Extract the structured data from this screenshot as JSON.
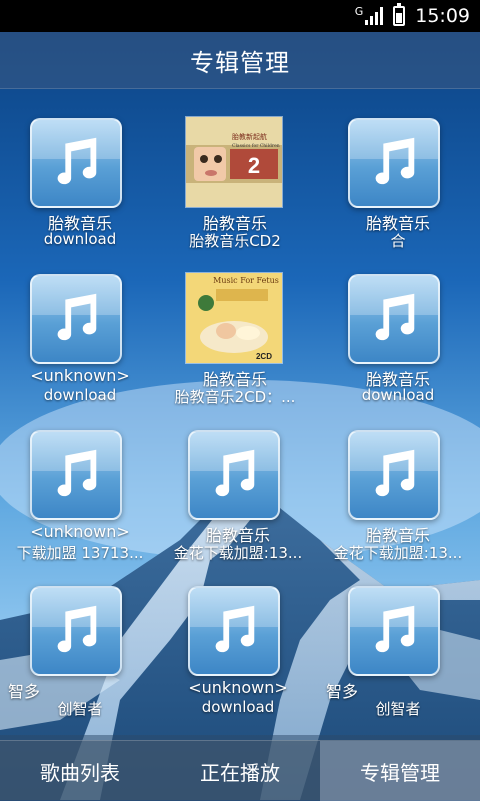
{
  "status_bar": {
    "network": "G",
    "time": "15:09",
    "battery_level": 0.6
  },
  "header": {
    "title": "专辑管理"
  },
  "albums": [
    {
      "icon": "music-note-icon",
      "line1": "胎教音乐",
      "line2": "download"
    },
    {
      "icon": "album-cover-classics",
      "line1": "胎教音乐",
      "line2": "胎教音乐CD2"
    },
    {
      "icon": "music-note-icon",
      "line1": "胎教音乐",
      "line2": "合"
    },
    {
      "icon": "music-note-icon",
      "line1": "<unknown>",
      "line2": "download"
    },
    {
      "icon": "album-cover-music-for-fetus",
      "line1": "胎教音乐",
      "line2": "胎教音乐2CD：..."
    },
    {
      "icon": "music-note-icon",
      "line1": "胎教音乐",
      "line2": "download"
    },
    {
      "icon": "music-note-icon",
      "line1": "<unknown>",
      "line2": "下载加盟 13713..."
    },
    {
      "icon": "music-note-icon",
      "line1": "胎教音乐",
      "line2": "金花下载加盟:13..."
    },
    {
      "icon": "music-note-icon",
      "line1": "胎教音乐",
      "line2": "金花下载加盟:13..."
    },
    {
      "icon": "music-note-icon",
      "line1": "智多",
      "line2": "创智者"
    },
    {
      "icon": "music-note-icon",
      "line1": "<unknown>",
      "line2": "download"
    },
    {
      "icon": "music-note-icon",
      "line1": "智多",
      "line2": "创智者"
    }
  ],
  "cover1": {
    "top_text": "胎教新起航",
    "mid_text": "Classics for Children",
    "number": "2"
  },
  "cover2": {
    "top_text": "Music For Fetus",
    "bottom_badge": "2CD"
  },
  "bottom_nav": [
    {
      "label": "歌曲列表",
      "active": false
    },
    {
      "label": "正在播放",
      "active": false
    },
    {
      "label": "专辑管理",
      "active": true
    }
  ]
}
